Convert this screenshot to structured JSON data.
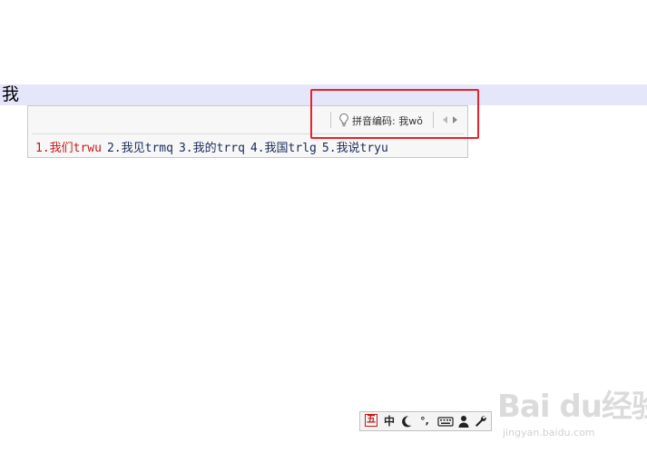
{
  "editor": {
    "text": "我"
  },
  "hint": {
    "text": "拼音编码: 我wǒ"
  },
  "candidates": [
    {
      "label": "1.我们trwu",
      "selected": true
    },
    {
      "label": "2.我见trmq",
      "selected": false
    },
    {
      "label": "3.我的trrq",
      "selected": false
    },
    {
      "label": "4.我国trlg",
      "selected": false
    },
    {
      "label": "5.我说tryu",
      "selected": false
    }
  ],
  "toolbar": {
    "logo": "五",
    "mode": "中",
    "punct": "°,",
    "icons": [
      "wubi-logo-icon",
      "moon-icon",
      "punctuation-icon",
      "keyboard-icon",
      "user-icon",
      "wrench-icon"
    ]
  },
  "colors": {
    "highlight": "#e8212a",
    "selected": "#c21a1a",
    "candidate": "#1a2b5a"
  },
  "watermark": {
    "main": "Bai du经验",
    "sub": "jingyan.baidu.com"
  }
}
